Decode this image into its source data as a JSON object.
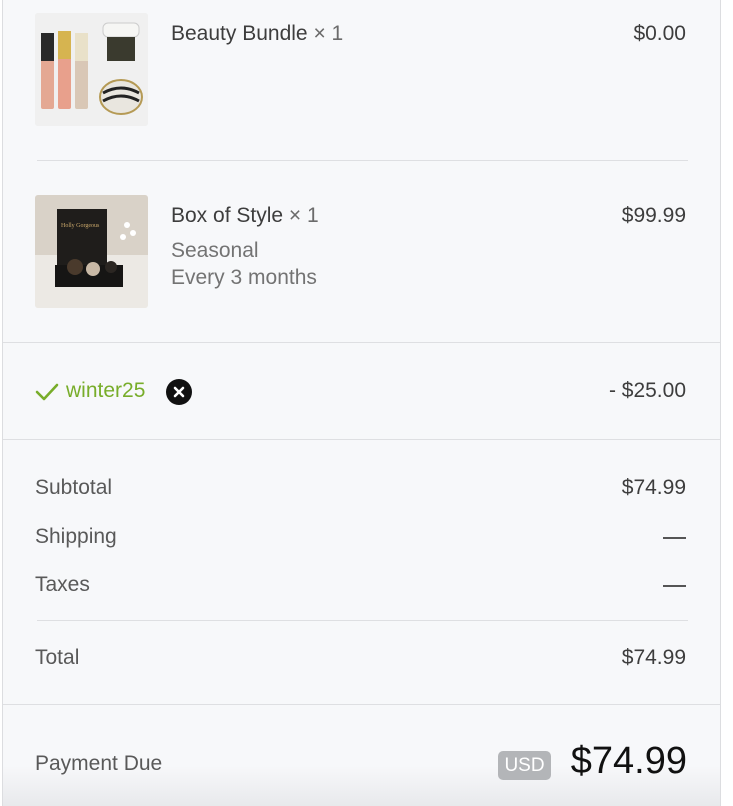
{
  "items": [
    {
      "name": "Beauty Bundle",
      "qty": "× 1",
      "price": "$0.00",
      "image_icon": "beauty-bundle-image"
    },
    {
      "name": "Box of Style",
      "qty": "× 1",
      "price": "$99.99",
      "subscription_label": "Seasonal",
      "frequency": "Every 3 months",
      "image_icon": "box-of-style-image",
      "box_text": "Holly Gorgeous"
    }
  ],
  "discount": {
    "code": "winter25",
    "amount": "- $25.00",
    "accent_color": "#78ad2a"
  },
  "summary": {
    "subtotal_label": "Subtotal",
    "subtotal": "$74.99",
    "shipping_label": "Shipping",
    "taxes_label": "Taxes",
    "total_label": "Total",
    "total": "$74.99"
  },
  "payment": {
    "label": "Payment Due",
    "currency": "USD",
    "amount": "$74.99"
  }
}
